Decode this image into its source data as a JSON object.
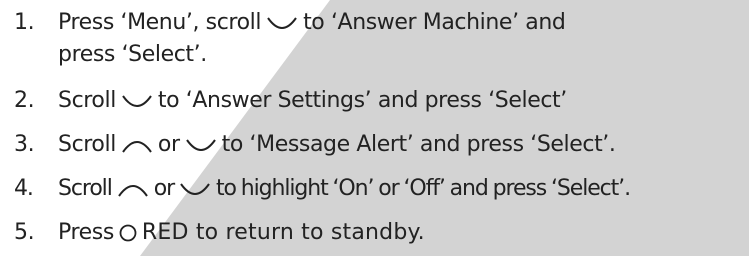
{
  "steps": [
    {
      "number": "1.",
      "parts": [
        "Press ‘Menu’, scroll",
        "to ‘Answer Machine’ and"
      ],
      "continuation": "press ‘Select’.",
      "icons": [
        "scroll-down-icon"
      ]
    },
    {
      "number": "2.",
      "parts": [
        "Scroll",
        "to ‘Answer Settings’ and press ‘Select’"
      ],
      "icons": [
        "scroll-down-icon"
      ]
    },
    {
      "number": "3.",
      "parts": [
        "Scroll",
        "or",
        "to ‘Message Alert’ and press ‘Select’."
      ],
      "icons": [
        "scroll-up-icon",
        "scroll-down-icon"
      ]
    },
    {
      "number": "4.",
      "parts": [
        "Scroll",
        "or",
        "to highlight ‘On’ or ‘Off’ and press ‘Select’."
      ],
      "icons": [
        "scroll-up-icon",
        "scroll-down-icon"
      ]
    },
    {
      "number": "5.",
      "parts": [
        "Press",
        "RED to return to standby."
      ],
      "icons": [
        "red-button-icon"
      ]
    }
  ],
  "colors": {
    "text": "#222222",
    "background_white": "#ffffff",
    "background_grey": "#d3d3d3"
  }
}
